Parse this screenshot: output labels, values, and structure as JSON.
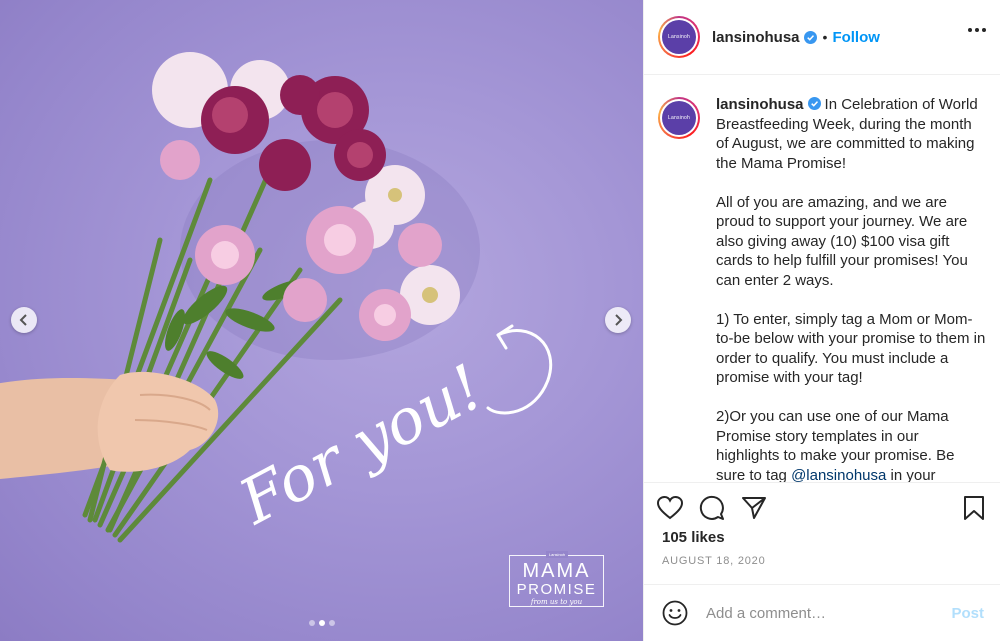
{
  "post": {
    "username": "lansinohusa",
    "follow_label": "Follow",
    "bullet": "•",
    "avatar_text": "Lansinoh",
    "caption_paragraphs": [
      "In Celebration of World Breastfeeding Week, during the month of August, we are committed to making the Mama Promise!",
      "All of you are amazing, and we are proud to support your journey. We are also giving away (10) $100 visa gift cards to help fulfill your promises! You can enter 2 ways.",
      "1) To enter, simply tag a Mom or Mom-to-be below with your promise to them in order to qualify. You must include a promise with your tag!",
      "2)Or you can use one of our Mama Promise story templates in our highlights to make your promise. Be sure to tag"
    ],
    "caption_mention": "@lansinohusa",
    "caption_tail": " in your",
    "likes": "105 likes",
    "date": "AUGUST 18, 2020",
    "comment_placeholder": "Add a comment…",
    "post_label": "Post"
  },
  "media": {
    "handwritten_text": "For you!",
    "logo": {
      "tab": "Lansinoh",
      "line1": "MAMA",
      "line2": "PROMISE",
      "line3": "from us to you"
    },
    "slide_count": 3,
    "active_slide": 2
  },
  "colors": {
    "background": "#9c8ed2",
    "accent": "#0095f6",
    "verified": "#3897f0",
    "post_disabled": "#b2dffc"
  },
  "icons": [
    "chevron-left-icon",
    "chevron-right-icon",
    "more-icon",
    "verified-badge-icon",
    "heart-icon",
    "comment-icon",
    "share-icon",
    "bookmark-icon",
    "emoji-icon"
  ]
}
